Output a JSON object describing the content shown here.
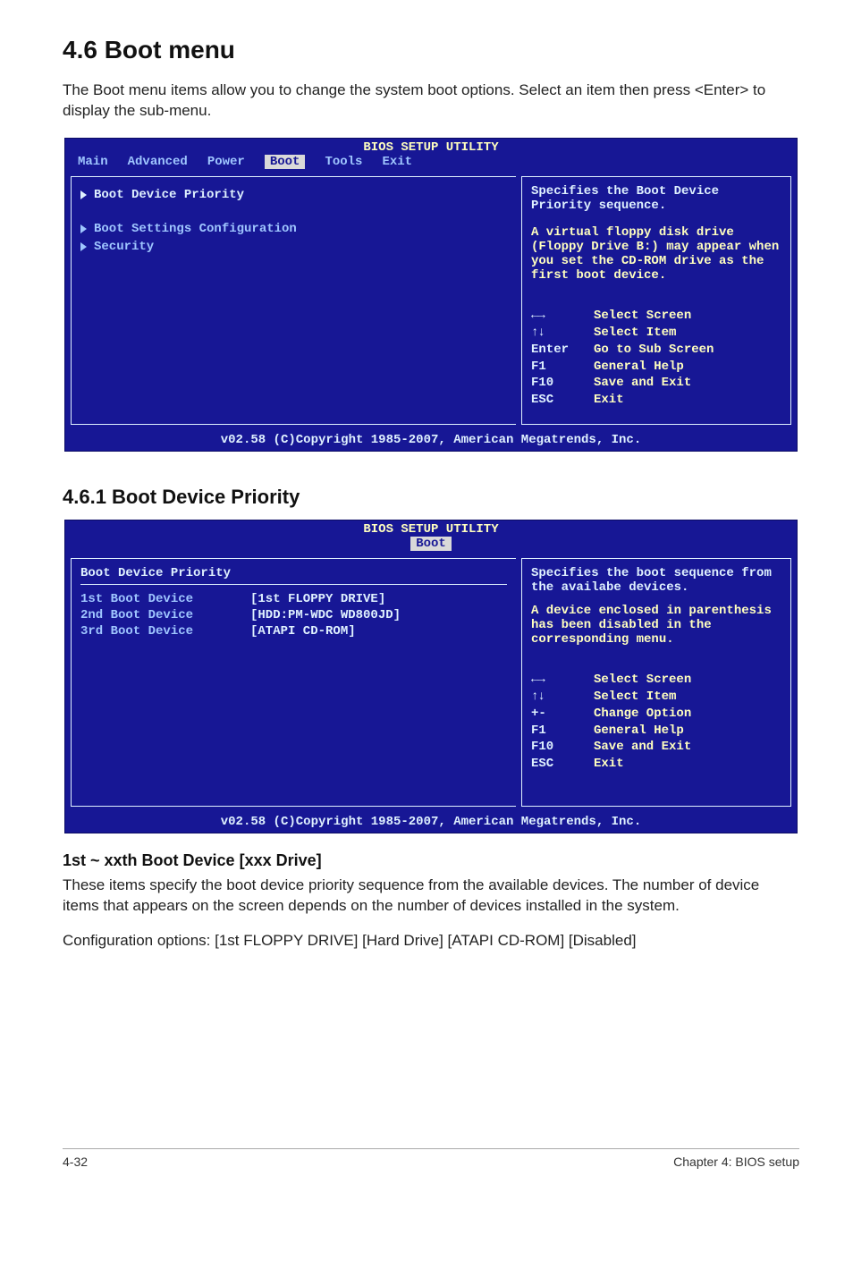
{
  "section": {
    "number_title": "4.6     Boot menu",
    "intro": "The Boot menu items allow you to change the system boot options. Select an item then press <Enter> to display the sub-menu."
  },
  "bios1": {
    "title": "BIOS SETUP UTILITY",
    "tabs": {
      "main": "Main",
      "advanced": "Advanced",
      "power": "Power",
      "boot": "Boot",
      "tools": "Tools",
      "exit": "Exit"
    },
    "left": {
      "items": {
        "priority": "Boot Device Priority",
        "settings": "Boot Settings Configuration",
        "security": "Security"
      }
    },
    "right": {
      "para1": "Specifies the Boot Device Priority sequence.",
      "para2": "A virtual floppy disk drive (Floppy Drive B:) may appear when you set the CD-ROM drive as the first boot device.",
      "help": {
        "lr_icon": "←→",
        "ud_icon": "↑↓",
        "select_screen": "Select Screen",
        "select_item": "Select Item",
        "enter_key": "Enter",
        "enter_lbl": "Go to Sub Screen",
        "f1_key": "F1",
        "f1_lbl": "General Help",
        "f10_key": "F10",
        "f10_lbl": "Save and Exit",
        "esc_key": "ESC",
        "esc_lbl": "Exit"
      }
    },
    "footer": "v02.58 (C)Copyright 1985-2007, American Megatrends, Inc."
  },
  "sub461": {
    "heading": "4.6.1      Boot Device Priority"
  },
  "bios2": {
    "title": "BIOS SETUP UTILITY",
    "tab": "Boot",
    "left": {
      "heading": "Boot Device Priority",
      "rows": {
        "r1k": "1st Boot Device",
        "r1v": "[1st FLOPPY DRIVE]",
        "r2k": "2nd Boot Device",
        "r2v": "[HDD:PM-WDC WD800JD]",
        "r3k": "3rd Boot Device",
        "r3v": "[ATAPI CD-ROM]"
      }
    },
    "right": {
      "para": "Specifies the boot sequence from the availabe devices.",
      "para2": "A device enclosed in parenthesis has been disabled in the corresponding menu.",
      "help": {
        "lr_icon": "←→",
        "ud_icon": "↑↓",
        "select_screen": "Select Screen",
        "select_item": "Select Item",
        "pm_key": "+-",
        "pm_lbl": "Change Option",
        "f1_key": "F1",
        "f1_lbl": "General Help",
        "f10_key": "F10",
        "f10_lbl": "Save and Exit",
        "esc_key": "ESC",
        "esc_lbl": "Exit"
      }
    },
    "footer": "v02.58 (C)Copyright 1985-2007, American Megatrends, Inc."
  },
  "subitem": {
    "heading": "1st ~ xxth Boot Device [xxx Drive]",
    "p1": "These items specify the boot device priority sequence from the available devices. The number of device items that appears on the screen depends on the number of devices installed in the system.",
    "p2": "Configuration options: [1st FLOPPY DRIVE] [Hard Drive] [ATAPI CD-ROM] [Disabled]"
  },
  "footer": {
    "left": "4-32",
    "right": "Chapter 4: BIOS setup"
  }
}
